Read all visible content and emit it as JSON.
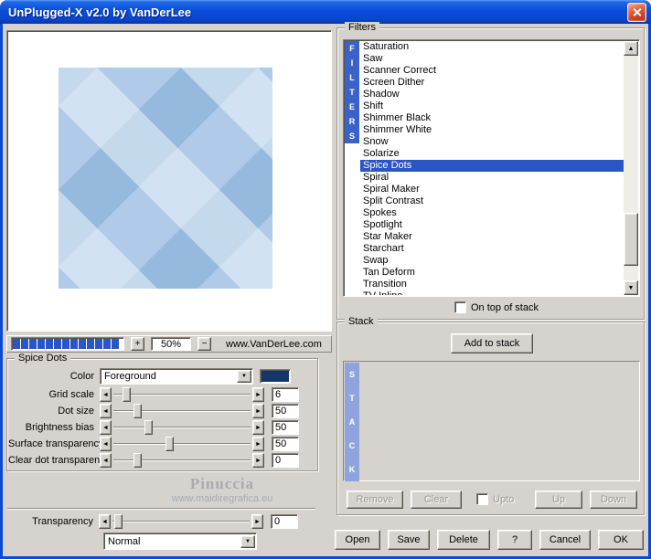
{
  "window": {
    "title": "UnPlugged-X v2.0 by VanDerLee"
  },
  "colors": {
    "accent": "#2A55C4",
    "filters_strip": "#3A62C8",
    "stack_strip": "#8FA4DC",
    "swatch": "#14366B"
  },
  "preview": {
    "segments": 13,
    "zoom_in": "+",
    "zoom": "50%",
    "zoom_out": "−",
    "website": "www.VanDerLee.com"
  },
  "params": {
    "group_label": "Spice Dots",
    "color_label": "Color",
    "color_value": "Foreground",
    "sliders": [
      {
        "label": "Grid scale",
        "value": "6",
        "pos": 7
      },
      {
        "label": "Dot size",
        "value": "50",
        "pos": 15
      },
      {
        "label": "Brightness bias",
        "value": "50",
        "pos": 23
      },
      {
        "label": "Surface transparency",
        "value": "50",
        "pos": 38
      },
      {
        "label": "Clear dot transparency",
        "value": "0",
        "pos": 15
      }
    ],
    "transparency": {
      "label": "Transparency",
      "value": "0",
      "pos": 2
    },
    "blend_mode": "Normal",
    "watermark_line1": "Pinuccia",
    "watermark_line2": "www.maidiregrafica.eu"
  },
  "filters": {
    "group_label": "Filters",
    "strip": [
      "F",
      "I",
      "L",
      "T",
      "E",
      "R",
      "S"
    ],
    "items": [
      "Saturation",
      "Saw",
      "Scanner Correct",
      "Screen Dither",
      "Shadow",
      "Shift",
      "Shimmer Black",
      "Shimmer White",
      "Snow",
      "Solarize",
      "Spice Dots",
      "Spiral",
      "Spiral Maker",
      "Split Contrast",
      "Spokes",
      "Spotlight",
      "Star Maker",
      "Starchart",
      "Swap",
      "Tan Deform",
      "Transition",
      "TV Inline"
    ],
    "selected": "Spice Dots",
    "on_top_label": "On top of stack"
  },
  "stack": {
    "group_label": "Stack",
    "add_button": "Add to stack",
    "strip": [
      "S",
      "T",
      "A",
      "C",
      "K"
    ],
    "remove": "Remove",
    "clear": "Clear",
    "upto": "Upto",
    "up": "Up",
    "down": "Down"
  },
  "footer": {
    "buttons": [
      "Open",
      "Save",
      "Delete",
      "?",
      "Cancel",
      "OK"
    ]
  }
}
